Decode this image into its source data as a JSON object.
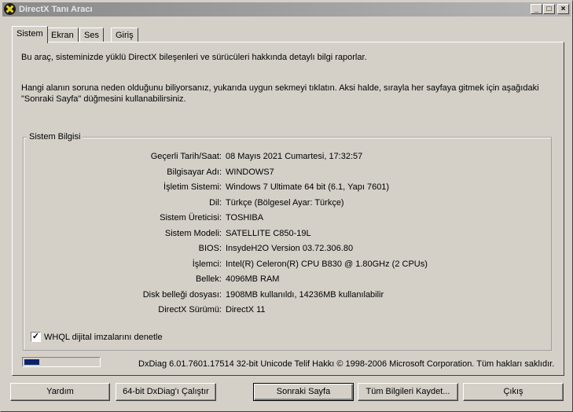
{
  "window": {
    "title": "DirectX Tanı Aracı",
    "controls": {
      "minimize": "_",
      "maximize": "□",
      "close": "×"
    }
  },
  "tabs": [
    {
      "label": "Sistem",
      "active": true
    },
    {
      "label": "Ekran",
      "active": false
    },
    {
      "label": "Ses",
      "active": false
    },
    {
      "label": "Giriş",
      "active": false
    }
  ],
  "intro": {
    "line1": "Bu araç, sisteminizde yüklü DirectX bileşenleri ve sürücüleri hakkında detaylı bilgi raporlar.",
    "line2": "Hangi alanın soruna neden olduğunu biliyorsanız, yukarıda uygun sekmeyi tıklatın.  Aksi halde, sırayla her sayfaya gitmek için aşağıdaki",
    "line3": "\"Sonraki Sayfa\" düğmesini kullanabilirsiniz."
  },
  "system_info": {
    "group_title": "Sistem Bilgisi",
    "rows": [
      {
        "label": "Geçerli Tarih/Saat:",
        "value": "08 Mayıs 2021 Cumartesi, 17:32:57"
      },
      {
        "label": "Bilgisayar Adı:",
        "value": "WINDOWS7"
      },
      {
        "label": "İşletim Sistemi:",
        "value": "Windows 7 Ultimate 64 bit (6.1, Yapı 7601)"
      },
      {
        "label": "Dil:",
        "value": "Türkçe (Bölgesel Ayar: Türkçe)"
      },
      {
        "label": "Sistem Üreticisi:",
        "value": "TOSHIBA"
      },
      {
        "label": "Sistem Modeli:",
        "value": "SATELLITE C850-19L"
      },
      {
        "label": "BIOS:",
        "value": "InsydeH2O Version 03.72.306.80"
      },
      {
        "label": "İşlemci:",
        "value": "Intel(R) Celeron(R) CPU B830 @ 1.80GHz (2 CPUs)"
      },
      {
        "label": "Bellek:",
        "value": "4096MB RAM"
      },
      {
        "label": "Disk belleği dosyası:",
        "value": "1908MB kullanıldı, 14236MB kullanılabilir"
      },
      {
        "label": "DirectX Sürümü:",
        "value": "DirectX 11"
      }
    ],
    "whql_label": "WHQL dijital imzalarını denetle",
    "whql_checked": true,
    "whql_mark": "✓"
  },
  "status": {
    "progress_fraction": 0.2,
    "progress_color": "#0a246a",
    "footer_text": "DxDiag 6.01.7601.17514 32-bit Unicode  Telif Hakkı © 1998-2006 Microsoft Corporation.  Tüm hakları saklıdır."
  },
  "buttons": {
    "help": "Yardım",
    "run64": "64-bit DxDiag'ı Çalıştır",
    "next": "Sonraki Sayfa",
    "save": "Tüm Bilgileri Kaydet...",
    "exit": "Çıkış"
  }
}
